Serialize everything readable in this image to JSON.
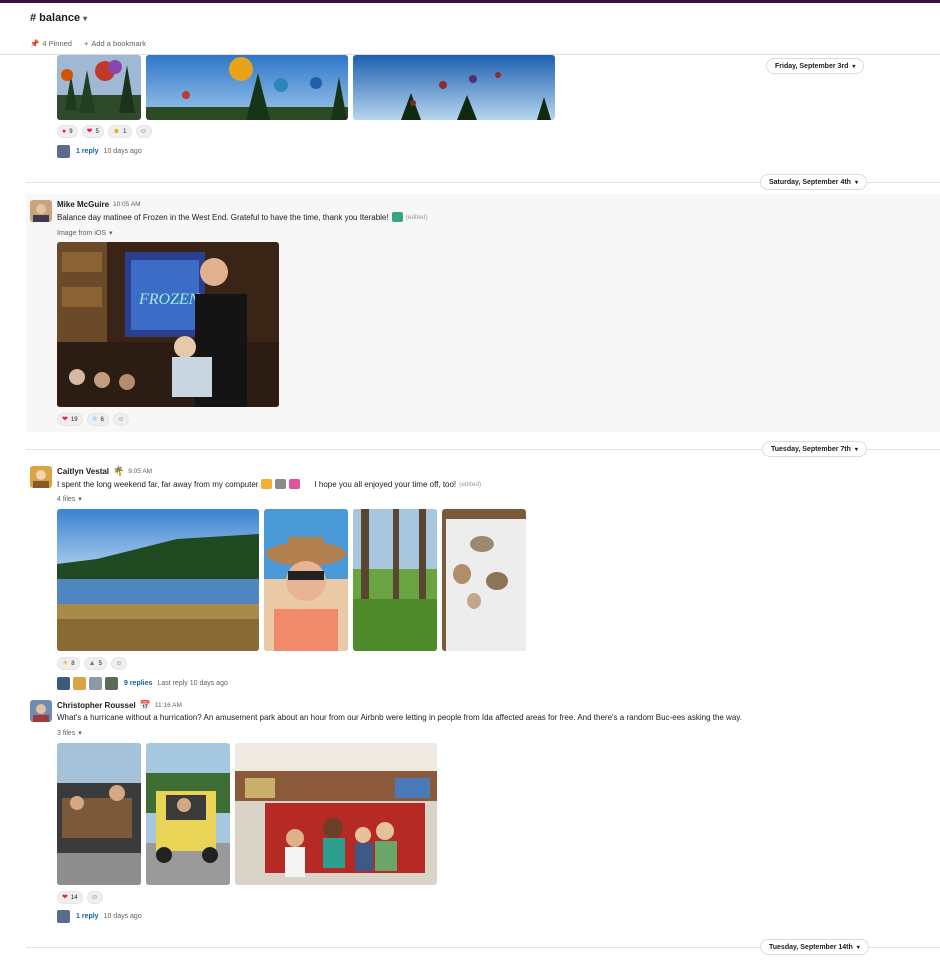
{
  "channel": {
    "name": "# balance",
    "pinned": "4 Pinned",
    "bookmark": "Add a bookmark"
  },
  "dates": {
    "d1": "Friday, September 3rd",
    "d2": "Saturday, September 4th",
    "d3": "Tuesday, September 7th",
    "d4": "Tuesday, September 14th"
  },
  "msg0": {
    "reactions": [
      {
        "emoji": "balloon",
        "count": "9"
      },
      {
        "emoji": "heart",
        "count": "5"
      },
      {
        "emoji": "hugging",
        "count": "1"
      }
    ],
    "reply": "1 reply",
    "ago": "10 days ago"
  },
  "msg1": {
    "author": "Mike McGuire",
    "time": "10:05 AM",
    "text": "Balance day matinee of Frozen in the West End. Grateful to have the time, thank you Iterable!",
    "edited": "(edited)",
    "files_label": "Image from iOS",
    "image_text": "FROZEN",
    "reactions": [
      {
        "emoji": "heart",
        "count": "19"
      },
      {
        "emoji": "snowflake",
        "count": "6"
      }
    ]
  },
  "msg2": {
    "author": "Caitlyn Vestal",
    "time": "9:05 AM",
    "text": "I spent the long weekend far, far away from my computer",
    "text2": "I hope you all enjoyed your time off, too!",
    "edited": "(edited)",
    "files_label": "4 files",
    "reactions": [
      {
        "emoji": "sun",
        "count": "8"
      },
      {
        "emoji": "mountain",
        "count": "5"
      }
    ],
    "reply": "9 replies",
    "ago": "Last reply 10 days ago"
  },
  "msg3": {
    "author": "Christopher Roussel",
    "time": "11:16 AM",
    "text": "What's a hurricane without a hurrication? An amusement park about an hour from our Airbnb were letting in people from Ida affected areas for free. And there's a random Buc-ees asking the way.",
    "files_label": "3 files",
    "reactions": [
      {
        "emoji": "heart",
        "count": "14"
      }
    ],
    "reply": "1 reply",
    "ago": "10 days ago"
  },
  "colors": {
    "link": "#1264a3",
    "aubergine": "#3f0e40",
    "heart": "#e01e5a"
  }
}
